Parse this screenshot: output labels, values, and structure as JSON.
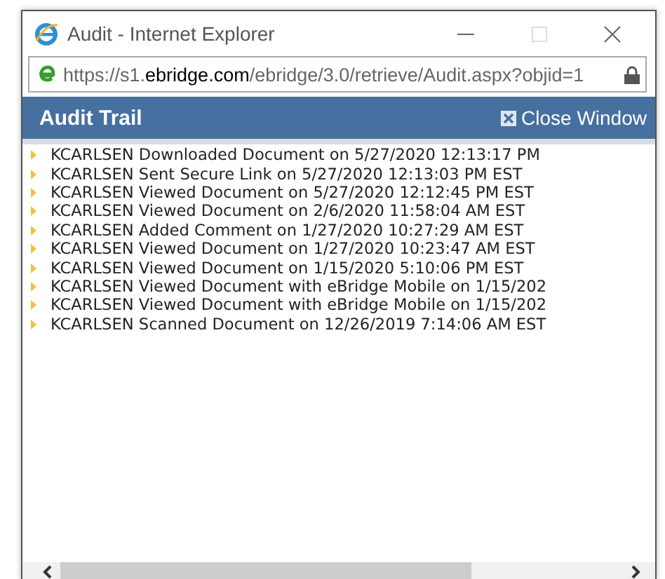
{
  "window": {
    "title": "Audit - Internet Explorer"
  },
  "address_bar": {
    "url_prefix": "https://s1.",
    "url_domain": "ebridge.com",
    "url_path": "/ebridge/3.0/retrieve/Audit.aspx?objid=1"
  },
  "header": {
    "title": "Audit Trail",
    "close_label": "Close Window"
  },
  "entries": [
    {
      "text": "KCARLSEN Downloaded Document on 5/27/2020 12:13:17 PM"
    },
    {
      "text": "KCARLSEN Sent Secure Link on 5/27/2020 12:13:03 PM EST"
    },
    {
      "text": "KCARLSEN Viewed Document on 5/27/2020 12:12:45 PM EST"
    },
    {
      "text": "KCARLSEN Viewed Document on 2/6/2020 11:58:04 AM EST"
    },
    {
      "text": "KCARLSEN Added Comment on 1/27/2020 10:27:29 AM EST"
    },
    {
      "text": "KCARLSEN Viewed Document on 1/27/2020 10:23:47 AM EST"
    },
    {
      "text": "KCARLSEN Viewed Document on 1/15/2020 5:10:06 PM EST"
    },
    {
      "text": "KCARLSEN Viewed Document with eBridge Mobile on 1/15/202"
    },
    {
      "text": "KCARLSEN Viewed Document with eBridge Mobile on 1/15/202"
    },
    {
      "text": "KCARLSEN Scanned Document on 12/26/2019 7:14:06 AM EST"
    }
  ]
}
